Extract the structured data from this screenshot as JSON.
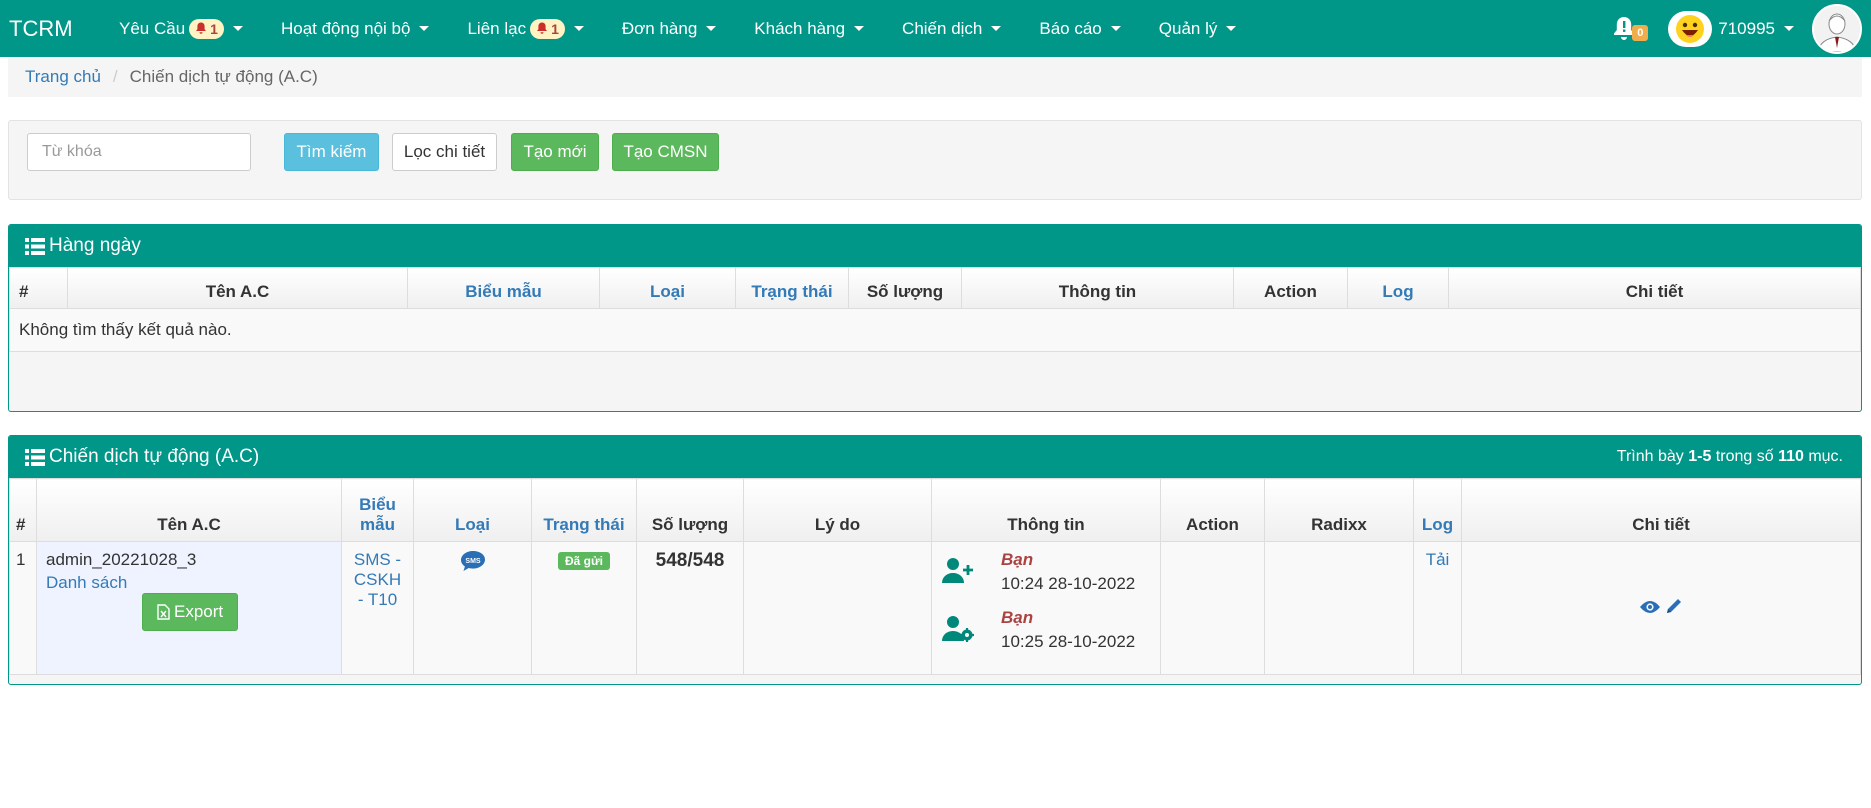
{
  "navbar": {
    "brand": "TCRM",
    "menu": [
      {
        "label": "Yêu Cầu",
        "badge": "1"
      },
      {
        "label": "Hoạt động nội bộ"
      },
      {
        "label": "Liên lạc",
        "badge": "1"
      },
      {
        "label": "Đơn hàng"
      },
      {
        "label": "Khách hàng"
      },
      {
        "label": "Chiến dịch"
      },
      {
        "label": "Báo cáo"
      },
      {
        "label": "Quản lý"
      }
    ],
    "alert_count": "0",
    "username": "710995",
    "colors": {
      "brand": "#009688",
      "badge_bg": "#fff3c4",
      "alert_badge": "#f0ad4e"
    }
  },
  "breadcrumb": {
    "home": "Trang chủ",
    "current": "Chiến dịch tự động (A.C)"
  },
  "search": {
    "placeholder": "Từ khóa",
    "value": "",
    "btn_search": "Tìm kiếm",
    "btn_filter": "Lọc chi tiết",
    "btn_new": "Tạo mới",
    "btn_cmsn": "Tạo CMSN"
  },
  "daily": {
    "title": "Hàng ngày",
    "columns": [
      "#",
      "Tên A.C",
      "Biểu mẫu",
      "Loại",
      "Trạng thái",
      "Số lượng",
      "Thông tin",
      "Action",
      "Log",
      "Chi tiết"
    ],
    "empty_text": "Không tìm thấy kết quả nào."
  },
  "auto": {
    "title": "Chiến dịch tự động (A.C)",
    "summary_prefix": "Trình bày",
    "summary_range": "1-5",
    "summary_mid": "trong số",
    "summary_total": "110",
    "summary_suffix": "mục.",
    "columns": [
      "#",
      "Tên A.C",
      "Biểu mẫu",
      "Loại",
      "Trạng thái",
      "Số lượng",
      "Lý do",
      "Thông tin",
      "Action",
      "Radixx",
      "Log",
      "Chi tiết"
    ],
    "rows": [
      {
        "index": "1",
        "name": "admin_20221028_3",
        "list_link": "Danh sách",
        "export_label": "Export",
        "template": "SMS - CSKH - T10",
        "type_icon": "sms-icon",
        "status": "Đã gửi",
        "quantity": "548/548",
        "reason": "",
        "info": [
          {
            "icon": "user-plus-icon",
            "who": "Bạn",
            "time": "10:24 28-10-2022"
          },
          {
            "icon": "user-cog-icon",
            "who": "Bạn",
            "time": "10:25 28-10-2022"
          }
        ],
        "log_link": "Tải"
      }
    ]
  }
}
